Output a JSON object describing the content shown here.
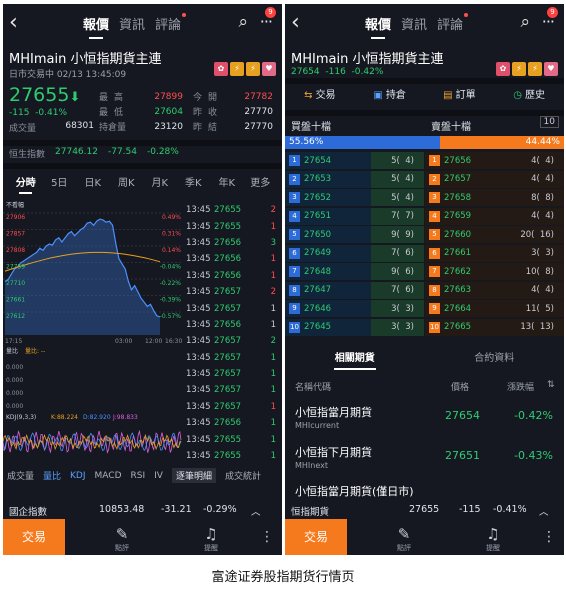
{
  "nav": {
    "tabs": [
      "報價",
      "資訊",
      "評論"
    ],
    "active": 0,
    "badge": "9"
  },
  "header": {
    "title": "MHImain  小恒指期貨主連",
    "subline": "日市交易中 02/13 13:45:09",
    "subline2": {
      "price": "27654",
      "change": "-116",
      "pct": "-0.42%"
    }
  },
  "quote": {
    "price": "27655",
    "change": "-115",
    "pct": "-0.41%",
    "volume_label": "成交量",
    "volume": "68301",
    "stats": [
      {
        "k": "最高",
        "v": "27899",
        "k2": "今開",
        "v2": "27782"
      },
      {
        "k": "最低",
        "v": "27604",
        "k2": "昨收",
        "v2": "27770"
      },
      {
        "k": "持倉量",
        "v": "23120",
        "k2": "昨結",
        "v2": "27770"
      }
    ]
  },
  "hsi": {
    "label": "恒生指數",
    "value": "27746.12",
    "change": "-77.54",
    "pct": "-0.28%"
  },
  "ktabs": [
    "分時",
    "5日",
    "日K",
    "周K",
    "月K",
    "季K",
    "年K",
    "更多"
  ],
  "chart": {
    "y_labels": [
      "27906",
      "27857",
      "27808",
      "27759",
      "27710",
      "27661",
      "27612"
    ],
    "pct_labels": [
      "0.49%",
      "0.31%",
      "0.14%",
      "-0.04%",
      "-0.22%",
      "-0.39%",
      "-0.57%"
    ],
    "tag": "不看幅",
    "start": "17:15",
    "mid": "03:00",
    "mid2": "12:00",
    "end": "16:30",
    "vol_labels": [
      "量比",
      "量比: --",
      "0.000",
      "0.000",
      "0.000",
      "0.000"
    ],
    "kdj_label": "KDJ(9,3,3)",
    "kdj_k": "K:88.224",
    "kdj_d": "D:82.920",
    "kdj_j": "J:98.833"
  },
  "ticks": [
    {
      "t": "13:45",
      "p": "27655",
      "q": "2",
      "c": "r"
    },
    {
      "t": "13:45",
      "p": "27655",
      "q": "1",
      "c": "r"
    },
    {
      "t": "13:45",
      "p": "27656",
      "q": "3",
      "c": "g"
    },
    {
      "t": "13:45",
      "p": "27656",
      "q": "1",
      "c": "r"
    },
    {
      "t": "13:45",
      "p": "27656",
      "q": "1",
      "c": "r"
    },
    {
      "t": "13:45",
      "p": "27657",
      "q": "2",
      "c": "r"
    },
    {
      "t": "13:45",
      "p": "27657",
      "q": "1",
      "c": "w"
    },
    {
      "t": "13:45",
      "p": "27656",
      "q": "1",
      "c": "w"
    },
    {
      "t": "13:45",
      "p": "27657",
      "q": "2",
      "c": "g"
    },
    {
      "t": "13:45",
      "p": "27657",
      "q": "1",
      "c": "g"
    },
    {
      "t": "13:45",
      "p": "27657",
      "q": "1",
      "c": "g"
    },
    {
      "t": "13:45",
      "p": "27657",
      "q": "1",
      "c": "g"
    },
    {
      "t": "13:45",
      "p": "27657",
      "q": "1",
      "c": "r"
    },
    {
      "t": "13:45",
      "p": "27656",
      "q": "1",
      "c": "g"
    },
    {
      "t": "13:45",
      "p": "27655",
      "q": "1",
      "c": "g"
    },
    {
      "t": "13:45",
      "p": "27655",
      "q": "1",
      "c": "g"
    }
  ],
  "indtabs": [
    "成交量",
    "量比",
    "KDJ",
    "MACD",
    "RSI",
    "IV",
    "逐筆明細",
    "成交統計"
  ],
  "bottom_index": {
    "name": "國企指數",
    "value": "10853.48",
    "change": "-31.21",
    "pct": "-0.29%"
  },
  "bottombar": {
    "trade": "交易",
    "comment": "點評",
    "alert": "提醒"
  },
  "panel2": {
    "actions": [
      "交易",
      "持倉",
      "訂單",
      "歷史"
    ],
    "ob_bid_title": "買盤十檔",
    "ob_ask_title": "賣盤十檔",
    "ob_n": "10",
    "bid_ratio": "55.56%",
    "ask_ratio": "44.44%",
    "bid_ratio_value": 55.56,
    "bids": [
      {
        "lv": "1",
        "p": "27654",
        "v": "5(",
        "n": "4)"
      },
      {
        "lv": "2",
        "p": "27653",
        "v": "5(",
        "n": "4)"
      },
      {
        "lv": "3",
        "p": "27652",
        "v": "5(",
        "n": "4)"
      },
      {
        "lv": "4",
        "p": "27651",
        "v": "7(",
        "n": "7)"
      },
      {
        "lv": "5",
        "p": "27650",
        "v": "9(",
        "n": "9)"
      },
      {
        "lv": "6",
        "p": "27649",
        "v": "7(",
        "n": "6)"
      },
      {
        "lv": "7",
        "p": "27648",
        "v": "9(",
        "n": "6)"
      },
      {
        "lv": "8",
        "p": "27647",
        "v": "7(",
        "n": "6)"
      },
      {
        "lv": "9",
        "p": "27646",
        "v": "3(",
        "n": "3)"
      },
      {
        "lv": "10",
        "p": "27645",
        "v": "3(",
        "n": "3)"
      }
    ],
    "asks": [
      {
        "lv": "1",
        "p": "27656",
        "v": "4(",
        "n": "4)"
      },
      {
        "lv": "2",
        "p": "27657",
        "v": "4(",
        "n": "4)"
      },
      {
        "lv": "3",
        "p": "27658",
        "v": "8(",
        "n": "8)"
      },
      {
        "lv": "4",
        "p": "27659",
        "v": "4(",
        "n": "4)"
      },
      {
        "lv": "5",
        "p": "27660",
        "v": "20(",
        "n": "16)"
      },
      {
        "lv": "6",
        "p": "27661",
        "v": "3(",
        "n": "3)"
      },
      {
        "lv": "7",
        "p": "27662",
        "v": "10(",
        "n": "8)"
      },
      {
        "lv": "8",
        "p": "27663",
        "v": "4(",
        "n": "4)"
      },
      {
        "lv": "9",
        "p": "27664",
        "v": "11(",
        "n": "5)"
      },
      {
        "lv": "10",
        "p": "27665",
        "v": "13(",
        "n": "13)"
      }
    ],
    "reltabs": [
      "相關期貨",
      "合約資料"
    ],
    "relhdr": {
      "name": "名稱代碼",
      "price": "價格",
      "chg": "漲跌幅"
    },
    "related": [
      {
        "name": "小恒指當月期貨",
        "code": "MHIcurrent",
        "price": "27654",
        "chg": "-0.42%"
      },
      {
        "name": "小恒指下月期貨",
        "code": "MHInext",
        "price": "27651",
        "chg": "-0.43%"
      },
      {
        "name": "小恒指當月期貨(僅日市)",
        "code": "",
        "price": "",
        "chg": ""
      }
    ],
    "bottom": {
      "name": "恒指期貨",
      "price": "27655",
      "change": "-115",
      "pct": "-0.41%"
    }
  },
  "caption": "富途证券股指期货行情页"
}
